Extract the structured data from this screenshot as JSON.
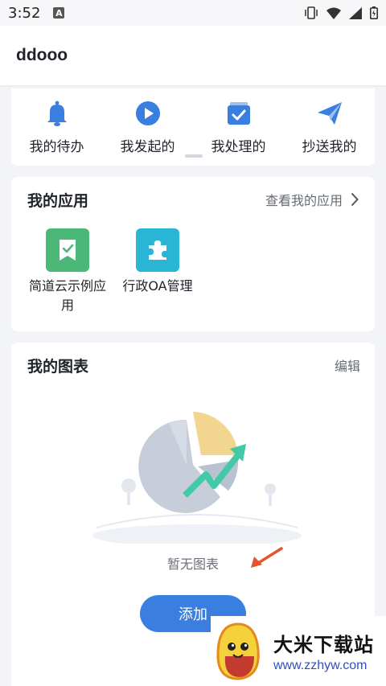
{
  "status_bar": {
    "time": "3:52",
    "notif_letter": "A"
  },
  "header": {
    "title": "ddooo"
  },
  "quick_actions": [
    {
      "label": "我的待办",
      "icon": "bell-icon"
    },
    {
      "label": "我发起的",
      "icon": "play-icon"
    },
    {
      "label": "我处理的",
      "icon": "check-calendar-icon"
    },
    {
      "label": "抄送我的",
      "icon": "paper-plane-icon"
    }
  ],
  "my_apps": {
    "title": "我的应用",
    "view_all": "查看我的应用",
    "items": [
      {
        "label": "简道云示例应用",
        "icon": "check-ribbon-icon",
        "color": "#4cb877"
      },
      {
        "label": "行政OA管理",
        "icon": "puzzle-icon",
        "color": "#29b6d6"
      }
    ]
  },
  "my_charts": {
    "title": "我的图表",
    "edit": "编辑",
    "empty_text": "暂无图表",
    "add_button": "添加"
  },
  "watermark": {
    "name": "大米下载站",
    "url": "www.zzhyw.com"
  },
  "colors": {
    "accent": "#3a7fe0",
    "arrow": "#e2552f"
  }
}
